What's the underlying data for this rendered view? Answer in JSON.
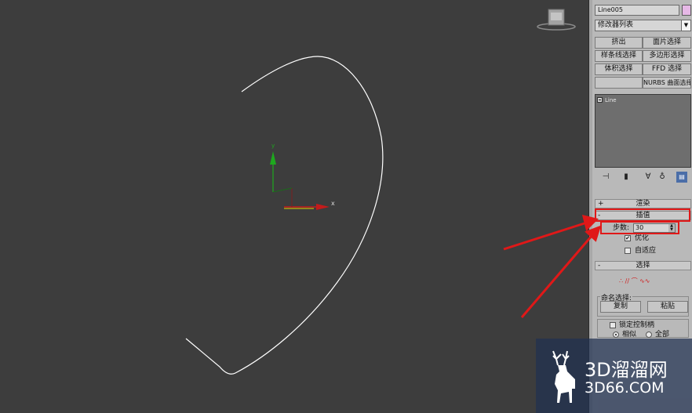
{
  "viewport": {
    "axis_x": "x",
    "axis_y": "y"
  },
  "object_name": "Line005",
  "object_color": "#e6b8e6",
  "modifier_list": "修改器列表",
  "modifier_buttons": [
    "挤出",
    "面片选择",
    "样条线选择",
    "多边形选择",
    "体积选择",
    "FFD 选择",
    "",
    "NURBS 曲面选择"
  ],
  "stack": {
    "items": [
      "Line"
    ]
  },
  "stack_tools": [
    "pin-icon",
    "show-end-result-icon",
    "make-unique-icon",
    "remove-modifier-icon",
    "configure-modifier-sets-icon"
  ],
  "rollouts": {
    "render": {
      "sign": "+",
      "title": "渲染"
    },
    "interpolation": {
      "sign": "-",
      "title": "插值",
      "steps_label": "步数:",
      "steps_value": "30",
      "optimize_label": "优化",
      "optimize_checked": true,
      "adaptive_label": "自适应",
      "adaptive_checked": false
    },
    "selection": {
      "sign": "-",
      "title": "选择",
      "vertex_text": "",
      "named_group_title": "命名选择:",
      "copy_label": "复制",
      "paste_label": "粘贴",
      "lock_handles_label": "锁定控制柄",
      "alike_label": "相似",
      "all_label": "全部"
    }
  },
  "annotation_color": "#e01818",
  "watermark": {
    "line1": "3D溜溜网",
    "line2": "3D66.COM"
  }
}
